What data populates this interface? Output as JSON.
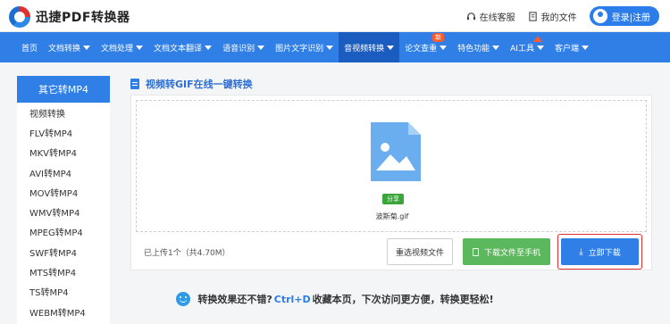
{
  "brand": {
    "name": "迅捷PDF转换器"
  },
  "header": {
    "service_label": "在线客服",
    "files_label": "我的文件",
    "login_label": "登录|注册"
  },
  "nav": {
    "items": [
      {
        "label": "首页",
        "has_caret": false
      },
      {
        "label": "文档转换",
        "has_caret": true
      },
      {
        "label": "文档处理",
        "has_caret": true
      },
      {
        "label": "文档文本翻译",
        "has_caret": true
      },
      {
        "label": "语音识别",
        "has_caret": true
      },
      {
        "label": "图片文字识别",
        "has_caret": true
      },
      {
        "label": "音视频转换",
        "has_caret": true,
        "active": true
      },
      {
        "label": "论文查重",
        "has_caret": true,
        "badge": "新"
      },
      {
        "label": "特色功能",
        "has_caret": true
      },
      {
        "label": "AI工具",
        "has_caret": true,
        "badge_triangle": true
      },
      {
        "label": "客户端",
        "has_caret": true
      }
    ]
  },
  "sidebar": {
    "heading": "其它转MP4",
    "items": [
      "视频转换",
      "FLV转MP4",
      "MKV转MP4",
      "AVI转MP4",
      "MOV转MP4",
      "WMV转MP4",
      "MPEG转MP4",
      "SWF转MP4",
      "MTS转MP4",
      "TS转MP4",
      "WEBM转MP4"
    ]
  },
  "main": {
    "title": "视频转GIF在线一键转换",
    "file": {
      "share_tag": "分享",
      "name": "波斯菊.gif"
    },
    "upload_info": "已上传1个（共4.70M）",
    "buttons": {
      "reselect": "重选视频文件",
      "send_phone": "下载文件至手机",
      "download": "立即下载"
    }
  },
  "tip": {
    "prefix": "转换效果还不错?",
    "hotkey": "Ctrl+D",
    "suffix": "收藏本页，下次访问更方便，转换更轻松!"
  },
  "colors": {
    "primary": "#2f7fe6",
    "nav_active": "#1a5cc0",
    "green": "#5cb85c",
    "highlight": "#e03030"
  }
}
